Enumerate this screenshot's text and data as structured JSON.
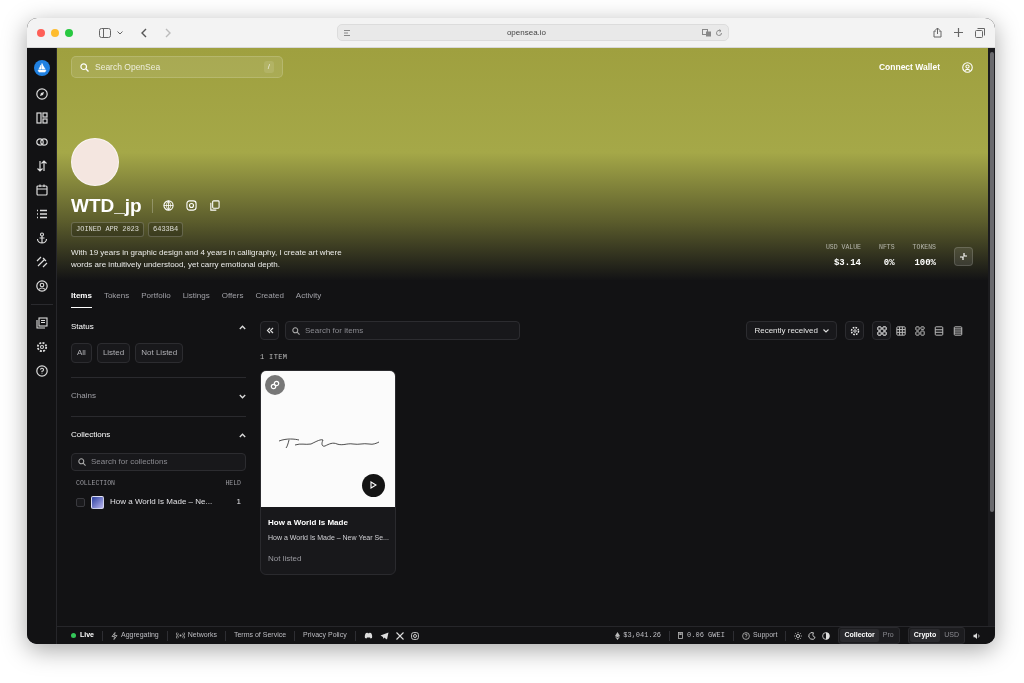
{
  "browser": {
    "url": "opensea.io"
  },
  "search": {
    "placeholder": "Search OpenSea",
    "shortcut": "/"
  },
  "connect_wallet": "Connect Wallet",
  "profile": {
    "name": "WTD_jp",
    "badges": [
      "JOINED APR 2023",
      "6433B4"
    ],
    "bio": "With 19 years in graphic design and 4 years in calligraphy, I create art where words are intuitively understood, yet carry emotional depth."
  },
  "stats": [
    {
      "label": "USD VALUE",
      "value": "$3.14"
    },
    {
      "label": "NFTS",
      "value": "0%"
    },
    {
      "label": "TOKENS",
      "value": "100%"
    }
  ],
  "tabs": [
    {
      "label": "Items",
      "selected": true
    },
    {
      "label": "Tokens",
      "selected": false
    },
    {
      "label": "Portfolio",
      "selected": false
    },
    {
      "label": "Listings",
      "selected": false
    },
    {
      "label": "Offers",
      "selected": false
    },
    {
      "label": "Created",
      "selected": false
    },
    {
      "label": "Activity",
      "selected": false
    }
  ],
  "filters": [
    {
      "kind": "chips",
      "title": "Status",
      "expanded": true,
      "options": [
        "All",
        "Listed",
        "Not Listed"
      ]
    },
    {
      "kind": "plain",
      "title": "Chains",
      "expanded": false
    },
    {
      "kind": "collections",
      "title": "Collections",
      "expanded": true,
      "placeholder": "Search for collections",
      "columns": [
        "COLLECTION",
        "HELD"
      ],
      "rows": [
        {
          "name": "How a World Is Made – Ne...",
          "held": "1",
          "checked": false
        }
      ]
    }
  ],
  "items": {
    "placeholder": "Search for items",
    "sort": "Recently received",
    "count": "1 ITEM",
    "view_modes": [
      {
        "kind": "grid-large",
        "selected": true
      },
      {
        "kind": "grid-small",
        "selected": false
      },
      {
        "kind": "grid-mixed",
        "selected": false
      },
      {
        "kind": "list",
        "selected": false
      },
      {
        "kind": "table",
        "selected": false
      }
    ],
    "cards": [
      {
        "title": "How a World Is Made",
        "subtitle": "How a World Is Made – New Year Se...",
        "status": "Not listed"
      }
    ]
  },
  "footer": {
    "live": "Live",
    "links": [
      "Aggregating",
      "Networks",
      "Terms of Service",
      "Privacy Policy"
    ],
    "eth_price": "$3,041.26",
    "gas": "0.06 GWEI",
    "support": "Support",
    "toggles": [
      [
        {
          "label": "Collector",
          "selected": true
        },
        {
          "label": "Pro",
          "selected": false
        }
      ],
      [
        {
          "label": "Crypto",
          "selected": true
        },
        {
          "label": "USD",
          "selected": false
        }
      ]
    ]
  }
}
